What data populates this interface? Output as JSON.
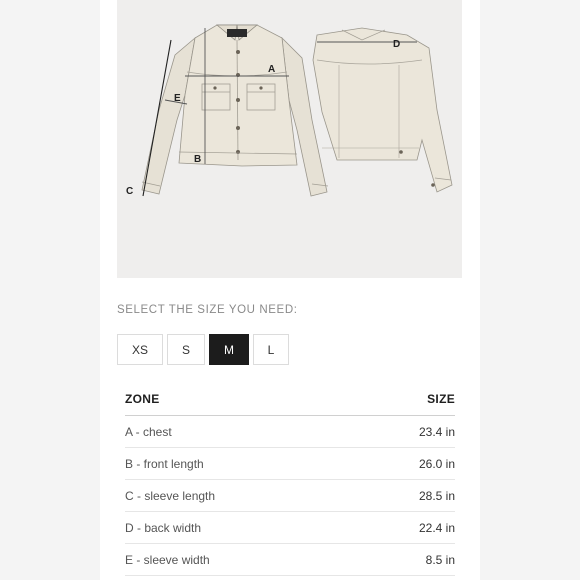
{
  "diagram": {
    "letters": [
      "A",
      "B",
      "C",
      "D",
      "E"
    ]
  },
  "size_selector": {
    "label": "SELECT THE SIZE YOU NEED:",
    "options": [
      {
        "label": "XS",
        "selected": false
      },
      {
        "label": "S",
        "selected": false
      },
      {
        "label": "M",
        "selected": true
      },
      {
        "label": "L",
        "selected": false
      }
    ]
  },
  "size_table": {
    "headers": [
      "ZONE",
      "SIZE"
    ],
    "rows": [
      {
        "zone": "A - chest",
        "size": "23.4 in"
      },
      {
        "zone": "B - front length",
        "size": "26.0 in"
      },
      {
        "zone": "C - sleeve length",
        "size": "28.5 in"
      },
      {
        "zone": "D - back width",
        "size": "22.4 in"
      },
      {
        "zone": "E - sleeve width",
        "size": "8.5 in"
      }
    ]
  },
  "colors": {
    "selected_bg": "#1c1c1c",
    "jacket_fill": "#e9e4d8",
    "image_bg": "#efeeed"
  }
}
